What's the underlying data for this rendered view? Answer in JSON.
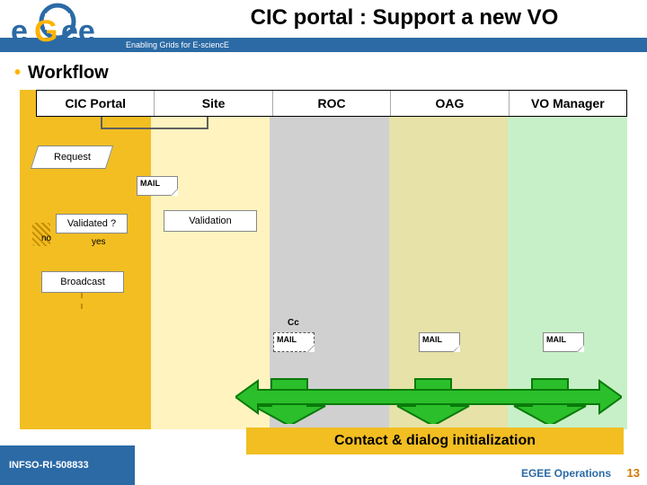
{
  "header": {
    "title": "CIC portal : Support  a new VO",
    "subtitle": "Enabling Grids for E-sciencE"
  },
  "logo": {
    "text1": "e",
    "text2": "ee",
    "middle": "G"
  },
  "bullet_label": "Workflow",
  "lanes": [
    "CIC Portal",
    "Site",
    "ROC",
    "OAG",
    "VO Manager"
  ],
  "flow": {
    "request": "Request",
    "mail": "MAIL",
    "validated_q": "Validated ?",
    "no": "no",
    "yes": "yes",
    "validation": "Validation",
    "broadcast": "Broadcast",
    "cc": "Cc",
    "contact": "Contact & dialog initialization"
  },
  "footer": {
    "left": "INFSO-RI-508833",
    "ops": "EGEE Operations",
    "page": "13"
  }
}
